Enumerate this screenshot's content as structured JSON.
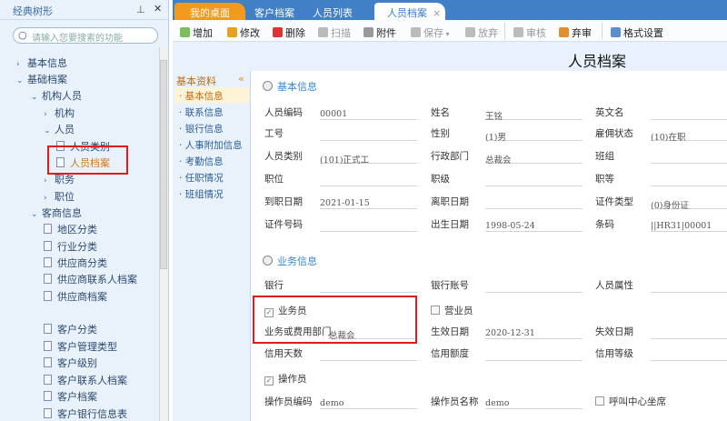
{
  "left_panel": {
    "title": "经典树形",
    "search_placeholder": "请输入您要搜索的功能",
    "tree": [
      {
        "label": "基本信息",
        "type": "collapsed"
      },
      {
        "label": "基础档案",
        "type": "expanded"
      },
      {
        "label": "机构人员",
        "type": "expanded"
      },
      {
        "label": "机构",
        "type": "collapsed"
      },
      {
        "label": "人员",
        "type": "expanded"
      },
      {
        "label": "人员类别",
        "type": "doc"
      },
      {
        "label": "人员档案",
        "type": "doc",
        "selected": true
      },
      {
        "label": "职务",
        "type": "collapsed"
      },
      {
        "label": "职位",
        "type": "collapsed"
      },
      {
        "label": "客商信息",
        "type": "expanded"
      },
      {
        "label": "地区分类",
        "type": "doc"
      },
      {
        "label": "行业分类",
        "type": "doc"
      },
      {
        "label": "供应商分类",
        "type": "doc"
      },
      {
        "label": "供应商联系人档案",
        "type": "doc"
      },
      {
        "label": "供应商档案",
        "type": "doc"
      },
      {
        "label": "客户分类",
        "type": "doc"
      },
      {
        "label": "客户管理类型",
        "type": "doc"
      },
      {
        "label": "客户级别",
        "type": "doc"
      },
      {
        "label": "客户联系人档案",
        "type": "doc"
      },
      {
        "label": "客户档案",
        "type": "doc"
      },
      {
        "label": "客户银行信息表",
        "type": "doc"
      }
    ]
  },
  "tabs": [
    "我的桌面",
    "客户档案",
    "人员列表",
    "人员档案"
  ],
  "toolbar": [
    "增加",
    "修改",
    "删除",
    "扫描",
    "附件",
    "保存",
    "放弃",
    "审核",
    "弃审",
    "格式设置"
  ],
  "page_title": "人员档案",
  "nav": {
    "title": "基本资料",
    "items": [
      "基本信息",
      "联系信息",
      "银行信息",
      "人事附加信息",
      "考勤信息",
      "任职情况",
      "班组情况"
    ]
  },
  "basic": {
    "title": "基本信息",
    "fields": [
      [
        "人员编码",
        "00001",
        "姓名",
        "王铭",
        "英文名",
        ""
      ],
      [
        "工号",
        "",
        "性别",
        "(1)男",
        "雇佣状态",
        "(10)在职"
      ],
      [
        "人员类别",
        "(101)正式工",
        "行政部门",
        "总裁会",
        "班组",
        ""
      ],
      [
        "职位",
        "",
        "职级",
        "",
        "职等",
        ""
      ],
      [
        "到职日期",
        "2021-01-15",
        "离职日期",
        "",
        "证件类型",
        "(0)身份证"
      ],
      [
        "证件号码",
        "",
        "出生日期",
        "1998-05-24",
        "条码",
        "||HR31|00001"
      ]
    ]
  },
  "business": {
    "title": "业务信息",
    "bank": "银行",
    "bank_account": "银行账号",
    "person_attr": "人员属性",
    "salesman": "业务员",
    "clerk": "营业员",
    "dept_label": "业务或费用部门",
    "dept_value": "总裁会",
    "eff_date_label": "生效日期",
    "eff_date": "2020-12-31",
    "exp_date_label": "失效日期",
    "credit_days": "信用天数",
    "credit_amount": "信用额度",
    "credit_level": "信用等级",
    "operator": "操作员",
    "op_code_label": "操作员编码",
    "op_code": "demo",
    "op_name_label": "操作员名称",
    "op_name": "demo",
    "callcenter": "呼叫中心坐席"
  }
}
